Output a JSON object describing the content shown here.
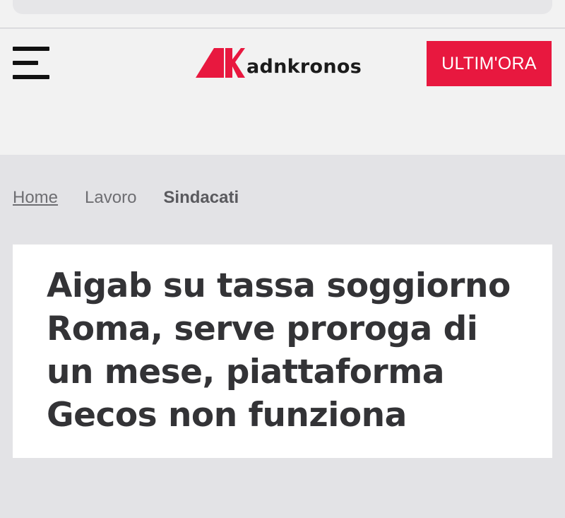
{
  "header": {
    "brand": "adnkronos",
    "ultimora_label": "ULTIM'ORA",
    "brand_color": "#e8183f"
  },
  "breadcrumb": {
    "home": "Home",
    "section": "Lavoro",
    "subsection": "Sindacati"
  },
  "article": {
    "title": "Aigab su tassa soggiorno Roma, serve proroga di un mese, piattaforma Gecos non funziona"
  }
}
